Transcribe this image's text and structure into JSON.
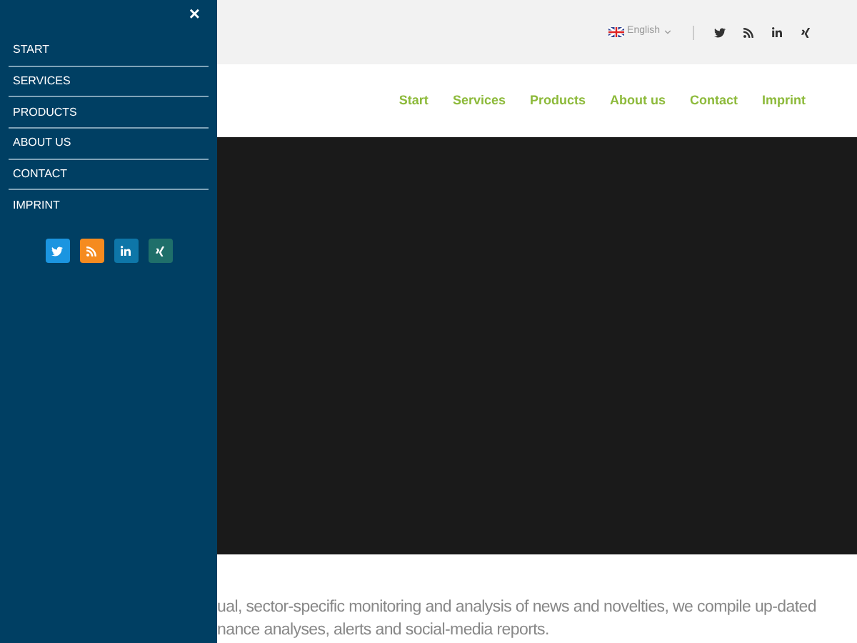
{
  "drawer": {
    "close": "×",
    "items": [
      {
        "label": "START"
      },
      {
        "label": "SERVICES"
      },
      {
        "label": "PRODUCTS"
      },
      {
        "label": "ABOUT US"
      },
      {
        "label": "CONTACT"
      },
      {
        "label": "IMPRINT"
      }
    ],
    "social": [
      {
        "kind": "twitter",
        "color": "#1b95e0"
      },
      {
        "kind": "rss",
        "color": "#f58b1f"
      },
      {
        "kind": "linkedin",
        "color": "#0e76a8"
      },
      {
        "kind": "xing",
        "color": "#1f6f6a"
      }
    ]
  },
  "top_bar": {
    "language": "English",
    "social": [
      {
        "kind": "twitter"
      },
      {
        "kind": "rss"
      },
      {
        "kind": "linkedin"
      },
      {
        "kind": "xing"
      }
    ]
  },
  "nav": [
    {
      "label": "Start"
    },
    {
      "label": "Services"
    },
    {
      "label": "Products"
    },
    {
      "label": "About us"
    },
    {
      "label": "Contact"
    },
    {
      "label": "Imprint"
    }
  ],
  "intro": [
    "ual, sector-specific monitoring and analysis of news and novelties, we compile up-dated",
    "nance analyses, alerts and social-media reports."
  ]
}
